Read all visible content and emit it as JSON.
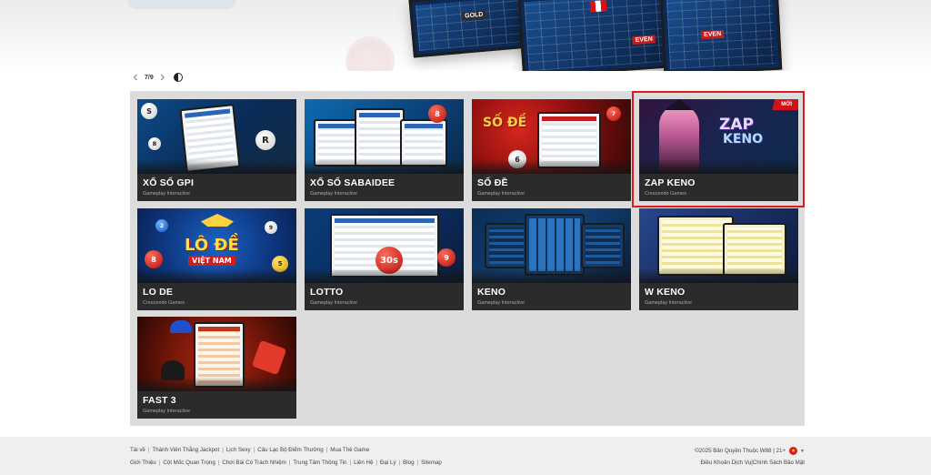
{
  "pager": {
    "prev_glyph": "‹",
    "next_glyph": "›",
    "count": "7/9"
  },
  "games": [
    {
      "title": "XỔ SỐ GPI",
      "provider": "Gameplay Interactive"
    },
    {
      "title": "XỔ SỐ SABAIDEE",
      "provider": "Gameplay Interactive"
    },
    {
      "title": "SỐ ĐỀ",
      "provider": "Gameplay Interactive"
    },
    {
      "title": "ZAP KENO",
      "provider": "Crescendo Games",
      "badge": "MỚI"
    },
    {
      "title": "LO DE",
      "provider": "Crescendo Games"
    },
    {
      "title": "LOTTO",
      "provider": "Gameplay Interactive"
    },
    {
      "title": "KENO",
      "provider": "Gameplay Interactive"
    },
    {
      "title": "W KENO",
      "provider": "Gameplay Interactive"
    },
    {
      "title": "FAST 3",
      "provider": "Gameplay Interactive"
    }
  ],
  "thumb_text": {
    "zap": "ZAP",
    "keno": "KENO",
    "lode": "LÔ ĐỀ",
    "vietnam": "VIỆT NAM",
    "ball_30s": "30s",
    "sode_logo": "SỐ ĐỀ",
    "banner_gold": "GOLD",
    "banner_even": "EVEN"
  },
  "footer": {
    "row1": [
      "Tài về",
      "Thành Viên Thắng Jackpot",
      "Lịch Sexy",
      "Câu Lạc Bộ Điểm Thưởng",
      "Mua Thẻ Game"
    ],
    "row2": [
      "Giới Thiệu",
      "Cột Mốc Quan Trọng",
      "Chơi Bài Có Trách Nhiệm",
      "Trung Tâm Thông Tin",
      "Liên Hệ",
      "Đại Lý",
      "Blog",
      "Sitemap"
    ],
    "copyright": "©2025 Bản Quyền Thuộc W88 | 21+",
    "row2_right": [
      "Điều Khoản Dịch Vụ",
      "Chính Sách Bảo Mật"
    ]
  },
  "colors": {
    "accent_red": "#e0181f",
    "panel_bg": "#dcdcdc",
    "card_bg": "#2b2b2b"
  }
}
